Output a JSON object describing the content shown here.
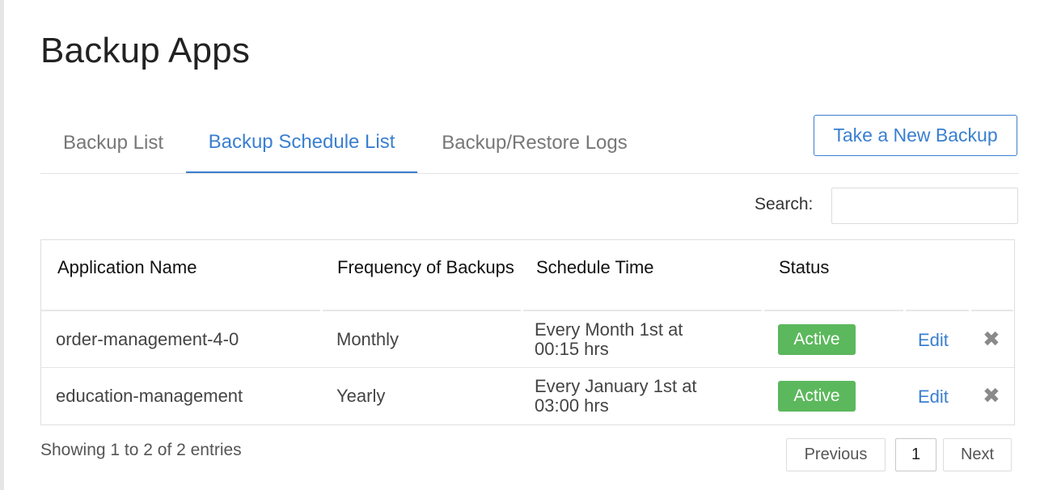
{
  "page": {
    "title": "Backup Apps"
  },
  "tabs": [
    {
      "label": "Backup List",
      "active": false
    },
    {
      "label": "Backup Schedule List",
      "active": true
    },
    {
      "label": "Backup/Restore Logs",
      "active": false
    }
  ],
  "actions": {
    "new_backup_label": "Take a New Backup"
  },
  "search": {
    "label": "Search:",
    "value": "",
    "placeholder": ""
  },
  "table": {
    "columns": [
      "Application Name",
      "Frequency of Backups",
      "Schedule Time",
      "Status"
    ],
    "rows": [
      {
        "app": "order-management-4-0",
        "frequency": "Monthly",
        "schedule": "Every Month 1st at 00:15 hrs",
        "status": "Active",
        "edit_label": "Edit",
        "delete_glyph": "✖"
      },
      {
        "app": "education-management",
        "frequency": "Yearly",
        "schedule": "Every January 1st at 03:00 hrs",
        "status": "Active",
        "edit_label": "Edit",
        "delete_glyph": "✖"
      }
    ]
  },
  "pagination": {
    "info": "Showing 1 to 2 of 2 entries",
    "previous": "Previous",
    "current": "1",
    "next": "Next"
  },
  "colors": {
    "accent": "#3a7fd0",
    "status_active": "#5cb85c"
  }
}
